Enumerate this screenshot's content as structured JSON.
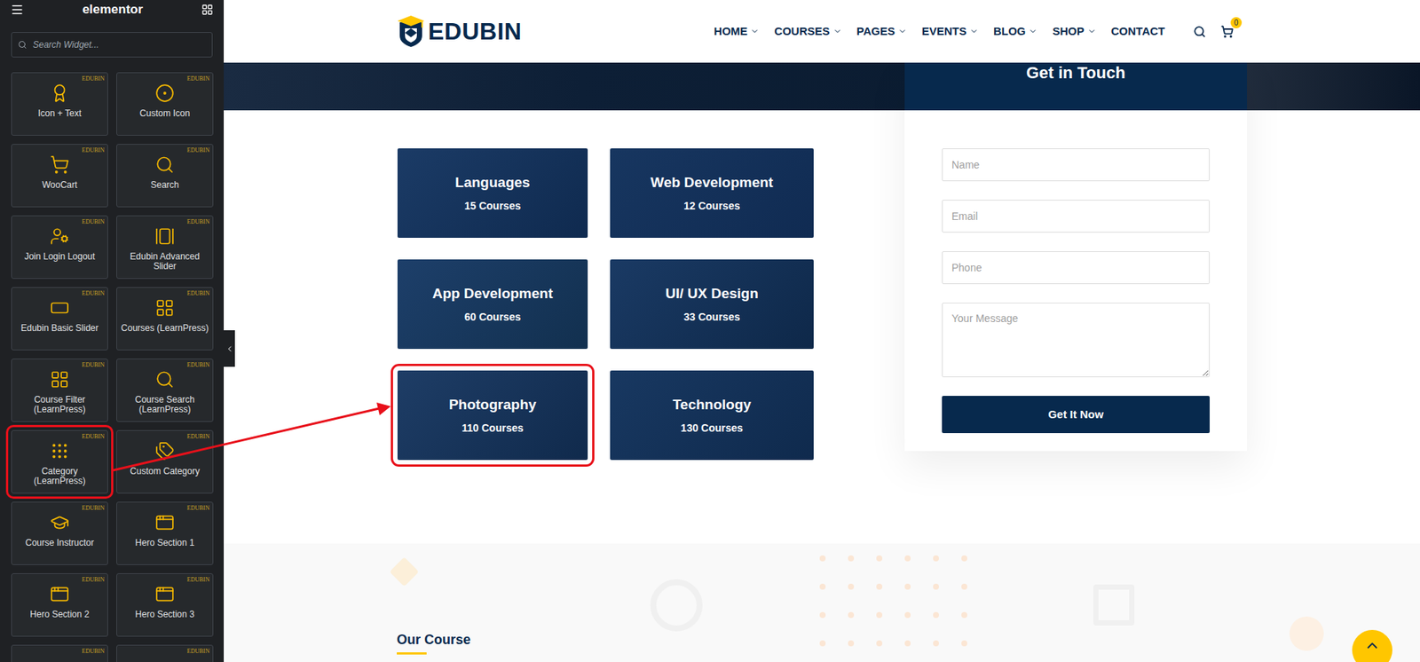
{
  "editor": {
    "brand": "elementor",
    "search_placeholder": "Search Widget...",
    "widgets": [
      {
        "label": "Icon + Text",
        "badge": "EDUBIN",
        "kind": "full",
        "highlighted": false
      },
      {
        "label": "Custom Icon",
        "badge": "EDUBIN",
        "kind": "full",
        "highlighted": false
      },
      {
        "label": "WooCart",
        "badge": "EDUBIN",
        "kind": "full",
        "highlighted": false
      },
      {
        "label": "Search",
        "badge": "EDUBIN",
        "kind": "full",
        "highlighted": false
      },
      {
        "label": "Join Login Logout",
        "badge": "EDUBIN",
        "kind": "full",
        "highlighted": false
      },
      {
        "label": "Edubin Advanced Slider",
        "badge": "EDUBIN",
        "kind": "full",
        "highlighted": false
      },
      {
        "label": "Edubin Basic Slider",
        "badge": "EDUBIN",
        "kind": "full",
        "highlighted": false
      },
      {
        "label": "Courses (LearnPress)",
        "badge": "EDUBIN",
        "kind": "full",
        "highlighted": false
      },
      {
        "label": "Course Filter (LearnPress)",
        "badge": "EDUBIN",
        "kind": "full",
        "highlighted": false
      },
      {
        "label": "Course Search (LearnPress)",
        "badge": "EDUBIN",
        "kind": "full",
        "highlighted": false
      },
      {
        "label": "Category (LearnPress)",
        "badge": "EDUBIN",
        "kind": "full",
        "highlighted": true
      },
      {
        "label": "Custom Category",
        "badge": "EDUBIN",
        "kind": "full",
        "highlighted": false
      },
      {
        "label": "Course Instructor",
        "badge": "EDUBIN",
        "kind": "full",
        "highlighted": false
      },
      {
        "label": "Hero Section 1",
        "badge": "EDUBIN",
        "kind": "full",
        "highlighted": false
      },
      {
        "label": "Hero Section 2",
        "badge": "EDUBIN",
        "kind": "full",
        "highlighted": false
      },
      {
        "label": "Hero Section 3",
        "badge": "EDUBIN",
        "kind": "full",
        "highlighted": false
      },
      {
        "label": "",
        "badge": "EDUBIN",
        "kind": "partial",
        "highlighted": false
      },
      {
        "label": "",
        "badge": "EDUBIN",
        "kind": "partial",
        "highlighted": false
      }
    ]
  },
  "header": {
    "logo": "EDUBIN",
    "nav": [
      {
        "label": "HOME",
        "dropdown": true
      },
      {
        "label": "COURSES",
        "dropdown": true
      },
      {
        "label": "PAGES",
        "dropdown": true
      },
      {
        "label": "EVENTS",
        "dropdown": true
      },
      {
        "label": "BLOG",
        "dropdown": true
      },
      {
        "label": "SHOP",
        "dropdown": true
      },
      {
        "label": "CONTACT",
        "dropdown": false
      }
    ],
    "cart_count": "0"
  },
  "categories": [
    {
      "title": "Languages",
      "count": "15 Courses",
      "highlighted": false
    },
    {
      "title": "Web Development",
      "count": "12 Courses",
      "highlighted": false
    },
    {
      "title": "App Development",
      "count": "60 Courses",
      "highlighted": false
    },
    {
      "title": "UI/ UX Design",
      "count": "33 Courses",
      "highlighted": false
    },
    {
      "title": "Photography",
      "count": "110 Courses",
      "highlighted": true
    },
    {
      "title": "Technology",
      "count": "130 Courses",
      "highlighted": false
    }
  ],
  "contact": {
    "title": "Get in Touch",
    "fields": [
      {
        "placeholder": "Name",
        "kind": "input"
      },
      {
        "placeholder": "Email",
        "kind": "input"
      },
      {
        "placeholder": "Phone",
        "kind": "input"
      },
      {
        "placeholder": "Your Message",
        "kind": "textarea"
      }
    ],
    "button": "Get It Now"
  },
  "courses_section": {
    "title": "Our Course"
  }
}
